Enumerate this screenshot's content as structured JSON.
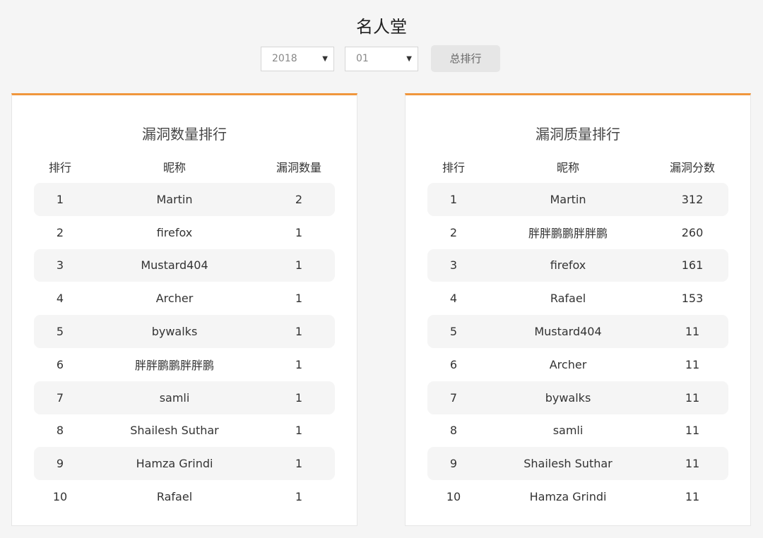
{
  "page": {
    "title": "名人堂"
  },
  "filters": {
    "year": "2018",
    "month": "01",
    "caret": "▼",
    "total_button": "总排行"
  },
  "quantity_board": {
    "title": "漏洞数量排行",
    "headers": [
      "排行",
      "昵称",
      "漏洞数量"
    ],
    "rows": [
      {
        "rank": "1",
        "name": "Martin",
        "value": "2"
      },
      {
        "rank": "2",
        "name": "firefox",
        "value": "1"
      },
      {
        "rank": "3",
        "name": "Mustard404",
        "value": "1"
      },
      {
        "rank": "4",
        "name": "Archer",
        "value": "1"
      },
      {
        "rank": "5",
        "name": "bywalks",
        "value": "1"
      },
      {
        "rank": "6",
        "name": "胖胖鹏鹏胖胖鹏",
        "value": "1"
      },
      {
        "rank": "7",
        "name": "samli",
        "value": "1"
      },
      {
        "rank": "8",
        "name": "Shailesh Suthar",
        "value": "1"
      },
      {
        "rank": "9",
        "name": "Hamza Grindi",
        "value": "1"
      },
      {
        "rank": "10",
        "name": "Rafael",
        "value": "1"
      }
    ]
  },
  "quality_board": {
    "title": "漏洞质量排行",
    "headers": [
      "排行",
      "昵称",
      "漏洞分数"
    ],
    "rows": [
      {
        "rank": "1",
        "name": "Martin",
        "value": "312"
      },
      {
        "rank": "2",
        "name": "胖胖鹏鹏胖胖鹏",
        "value": "260"
      },
      {
        "rank": "3",
        "name": "firefox",
        "value": "161"
      },
      {
        "rank": "4",
        "name": "Rafael",
        "value": "153"
      },
      {
        "rank": "5",
        "name": "Mustard404",
        "value": "11"
      },
      {
        "rank": "6",
        "name": "Archer",
        "value": "11"
      },
      {
        "rank": "7",
        "name": "bywalks",
        "value": "11"
      },
      {
        "rank": "8",
        "name": "samli",
        "value": "11"
      },
      {
        "rank": "9",
        "name": "Shailesh Suthar",
        "value": "11"
      },
      {
        "rank": "10",
        "name": "Hamza Grindi",
        "value": "11"
      }
    ]
  },
  "colors": {
    "accent": "#f0963c",
    "row_shade": "#f5f5f5",
    "page_bg": "#f5f5f5"
  }
}
